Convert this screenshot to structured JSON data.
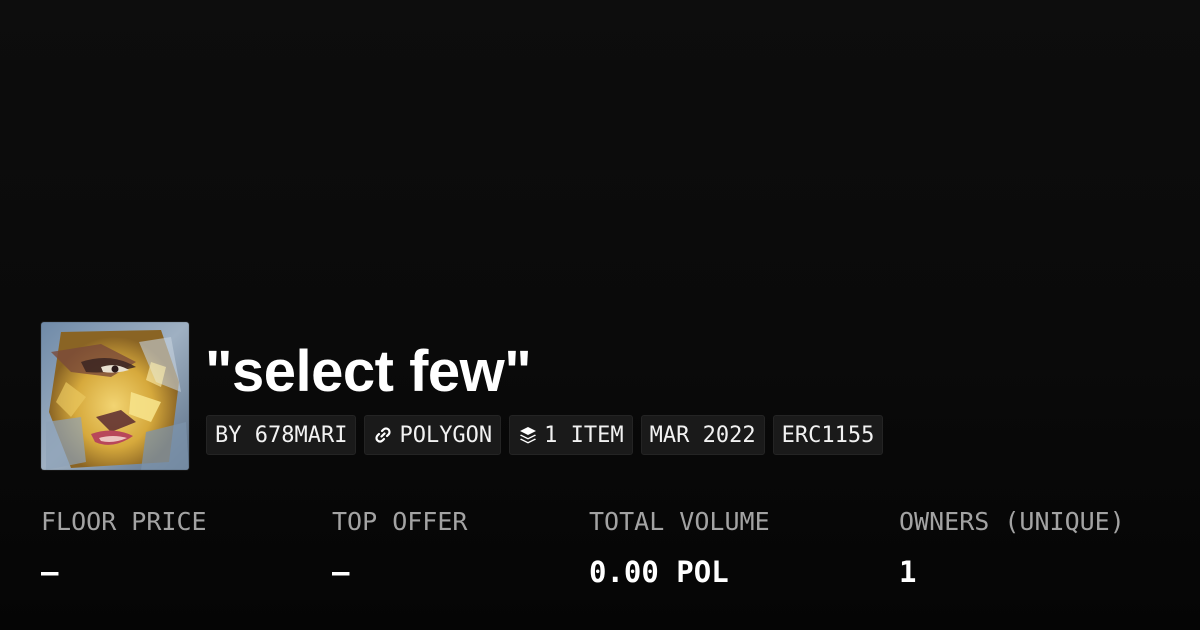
{
  "collection": {
    "title": "\"select few\"",
    "avatar_alt": "collection-artwork"
  },
  "badges": [
    {
      "label": "BY 678MARI",
      "icon": ""
    },
    {
      "label": "POLYGON",
      "icon": "chain-link-icon"
    },
    {
      "label": "1 ITEM",
      "icon": "layers-icon"
    },
    {
      "label": "MAR 2022",
      "icon": ""
    },
    {
      "label": "ERC1155",
      "icon": ""
    }
  ],
  "stats": [
    {
      "label": "FLOOR PRICE",
      "value": "–"
    },
    {
      "label": "TOP OFFER",
      "value": "–"
    },
    {
      "label": "TOTAL VOLUME",
      "value": "0.00 POL"
    },
    {
      "label": "OWNERS (UNIQUE)",
      "value": "1"
    }
  ],
  "colors": {
    "background": "#0a0a0a",
    "badge_bg": "#1a1a1a",
    "label": "#a3a3a3",
    "text": "#ffffff"
  }
}
